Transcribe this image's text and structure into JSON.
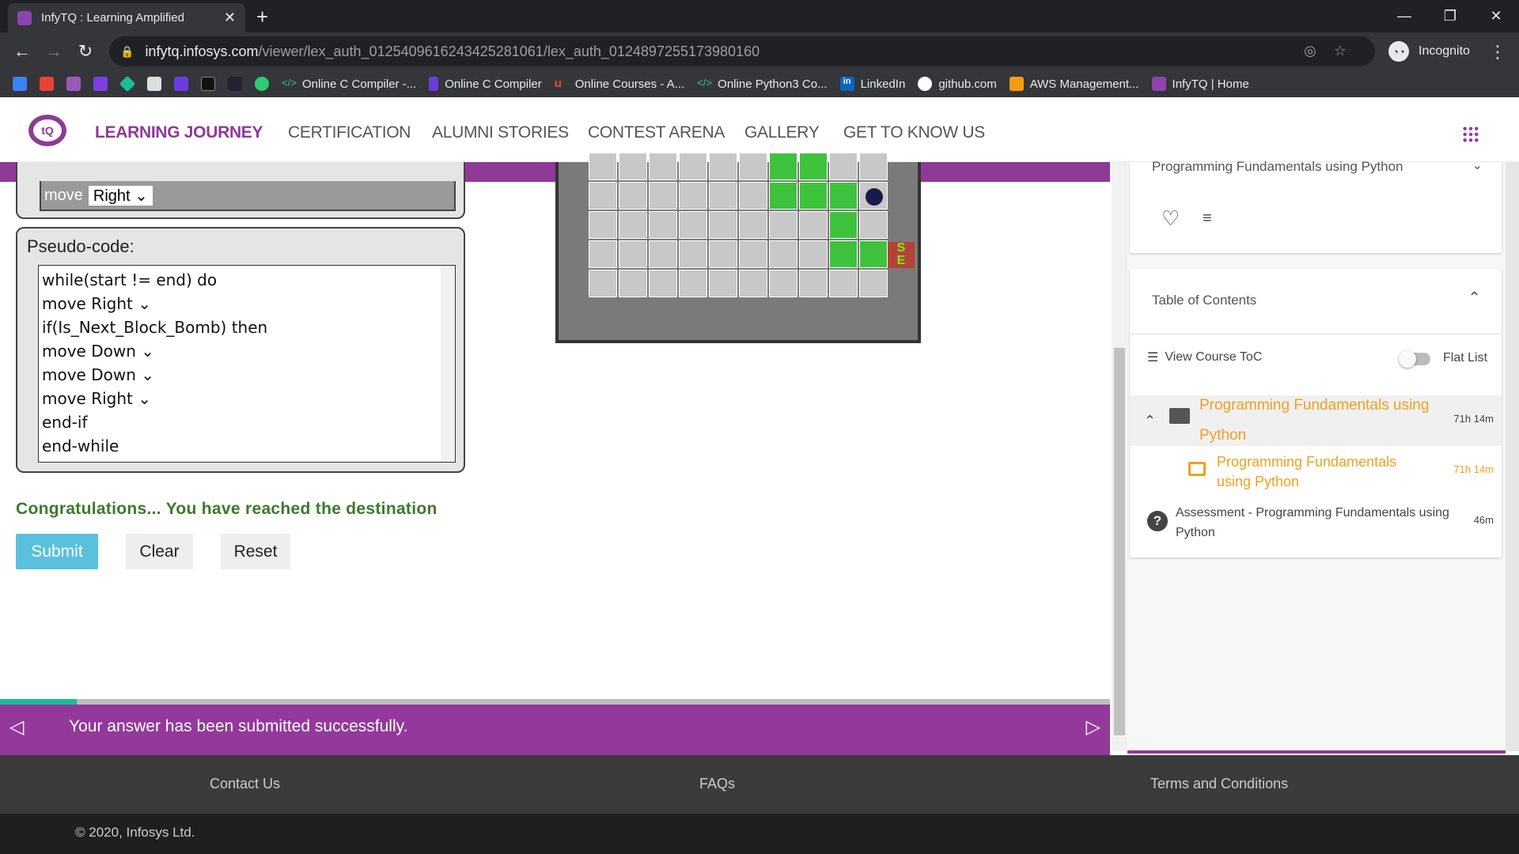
{
  "browser": {
    "tab_title": "InfyTQ : Learning Amplified",
    "new_tab": "+",
    "url_domain": "infytq.infosys.com",
    "url_path": "/viewer/lex_auth_012540961624342528106​1/lex_auth_0124897255173980160",
    "incognito_label": "Incognito",
    "bookmarks": [
      {
        "label": "Online C Compiler -...",
        "color": "#2ecc71"
      },
      {
        "label": "Online C Compiler",
        "color": "#6c3ce0"
      },
      {
        "label": "Online Courses - A...",
        "color": "#e74c3c"
      },
      {
        "label": "Online Python3 Co...",
        "color": "#2ecc71"
      },
      {
        "label": "LinkedIn",
        "color": "#0a66c2"
      },
      {
        "label": "github.com",
        "color": "#ffffff"
      },
      {
        "label": "AWS Management...",
        "color": "#f39c12"
      },
      {
        "label": "InfyTQ | Home",
        "color": "#8e44ad"
      }
    ]
  },
  "site": {
    "logo_text": "tQ",
    "nav": [
      "LEARNING JOURNEY",
      "CERTIFICATION",
      "ALUMNI STORIES",
      "CONTEST ARENA",
      "GALLERY",
      "GET TO KNOW US"
    ],
    "accent": "#8e3a96"
  },
  "editor": {
    "top_move_label": "move",
    "top_move_value": "Right ⌄",
    "pseudo_label": "Pseudo-code:",
    "code": [
      "while(start != end) do",
      "move  Right ⌄",
      "if(Is_Next_Block_Bomb) then",
      "move  Down ⌄",
      "move  Down ⌄",
      "move  Right ⌄",
      "end-if",
      "end-while"
    ],
    "congrats": "Congratulations... You have reached the destination",
    "submit": "Submit",
    "clear": "Clear",
    "reset": "Reset"
  },
  "game": {
    "bomb_icon": "bomb-icon",
    "start_label": "S",
    "end_label": "E"
  },
  "message_bar": {
    "text": "Your answer has been submitted successfully.",
    "prev": "◁",
    "next": "▷"
  },
  "right_panel": {
    "course_title": "Programming Fundamentals using Python",
    "toc_title": "Table of Contents",
    "view_toc": "View Course ToC",
    "flat_list": "Flat List",
    "module_title": "Programming Fundamentals using Python",
    "module_duration": "71h 14m",
    "sub_title": "Programming Fundamentals using Python",
    "sub_duration": "71h 14m",
    "assessment_title": "Assessment - Programming Fundamentals using Python",
    "assessment_duration": "46m"
  },
  "footer": {
    "contact": "Contact Us",
    "faqs": "FAQs",
    "terms": "Terms and Conditions",
    "copyright": "© 2020, Infosys Ltd."
  }
}
